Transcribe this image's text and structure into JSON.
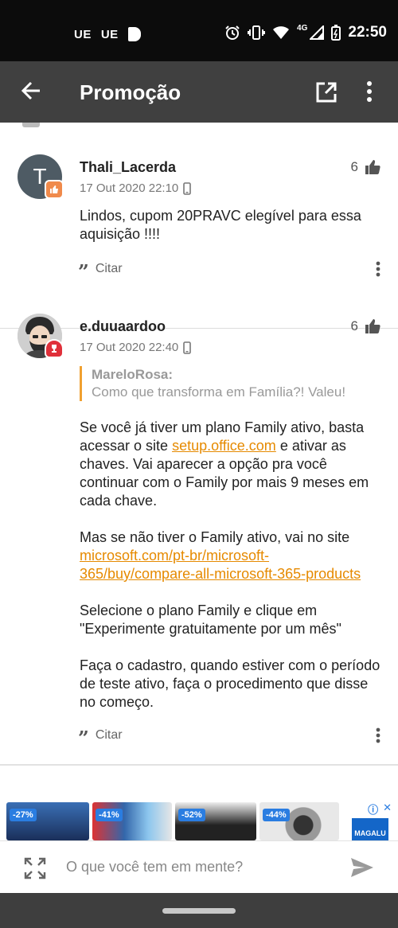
{
  "status_bar": {
    "left_labels": [
      "UE",
      "UE"
    ],
    "network": "4G",
    "time": "22:50"
  },
  "app_bar": {
    "title": "Promoção"
  },
  "comments": [
    {
      "avatar_letter": "T",
      "username": "Thali_Lacerda",
      "timestamp": "17 Out 2020 22:10",
      "likes": "6",
      "body": "Lindos, cupom 20PRAVC elegível para essa aquisição !!!!",
      "cite_label": "Citar"
    },
    {
      "username": "e.duuaardoo",
      "timestamp": "17 Out 2020 22:40",
      "likes": "6",
      "quote_author": "MareloRosa:",
      "quote_text": "Como que transforma em Família?! Valeu!",
      "p1_a": "Se você já tiver um plano Family ativo, basta acessar o site ",
      "p1_link": "setup.office.com",
      "p1_b": " e ativar as chaves. Vai aparecer a opção pra você continuar com o Family por mais 9 meses em cada chave.",
      "p2_a": "Mas se não tiver o Family ativo, vai no site ",
      "p2_link": "microsoft.com/pt-br/microsoft-365/buy/compare-all-microsoft-365-products",
      "p3": "Selecione o plano Family e clique em \"Experimente gratuitamente por um mês\"",
      "p4": "Faça o cadastro, quando estiver com o período de teste ativo, faça o procedimento que disse no começo.",
      "cite_label": "Citar"
    }
  ],
  "ad": {
    "tags": [
      "-27%",
      "-41%",
      "-52%",
      "-44%"
    ],
    "brand": "MAGALU"
  },
  "input": {
    "placeholder": "O que você tem em mente?"
  },
  "colors": {
    "accent": "#e68a00",
    "app_bar": "#404040"
  }
}
